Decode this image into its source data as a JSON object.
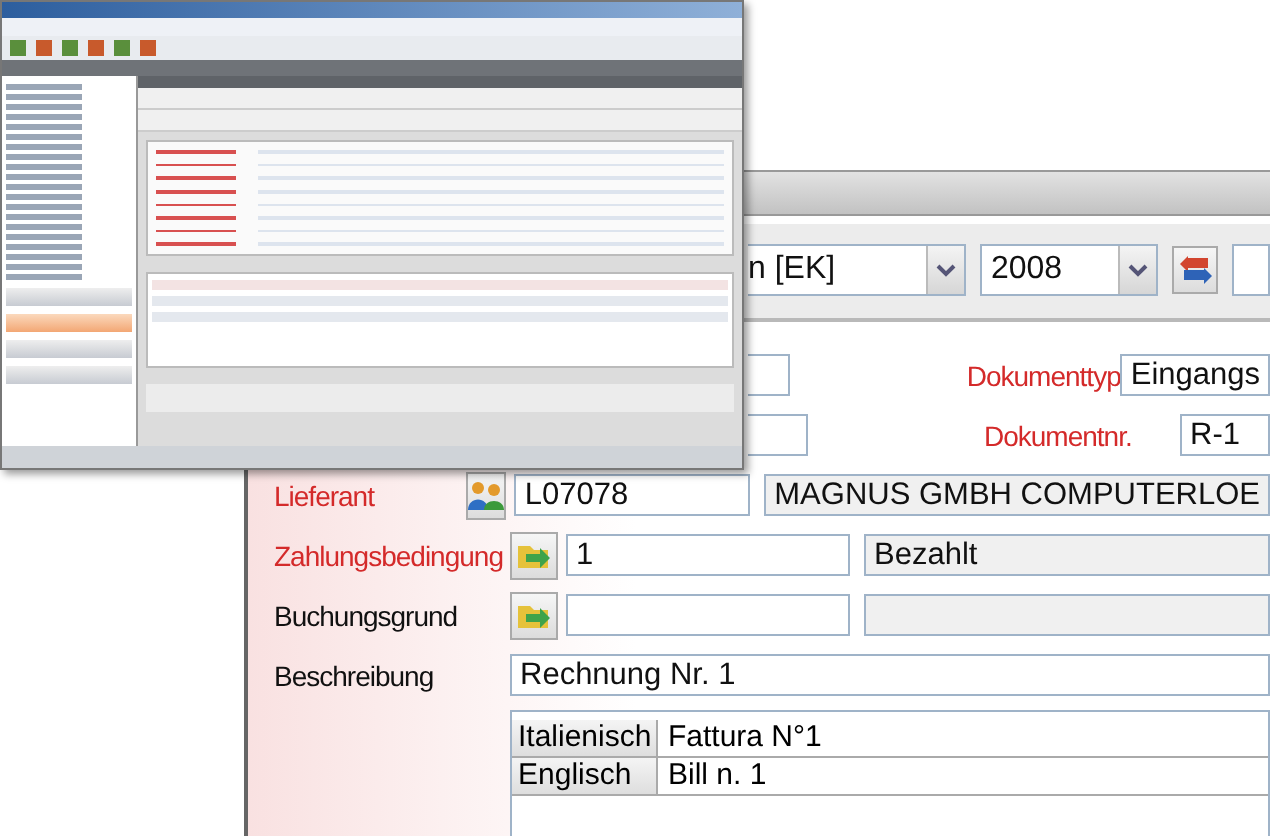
{
  "toolbar": {
    "booking_type": {
      "value": "n [EK]"
    },
    "year": {
      "value": "2008"
    }
  },
  "document_fields": [
    {
      "label": "Dokumenttyp",
      "required": true,
      "value": "Eingangs"
    },
    {
      "label": "Dokumentnr.",
      "required": true,
      "value": "R-1"
    }
  ],
  "lookups": [
    {
      "kind": "people",
      "label": "Lieferant",
      "required": true,
      "code": "L07078",
      "name": "MAGNUS GMBH COMPUTERLOE"
    },
    {
      "kind": "terms",
      "label": "Zahlungsbedingung",
      "required": true,
      "code": "1",
      "name": "Bezahlt"
    },
    {
      "kind": "terms",
      "label": "Buchungsgrund",
      "required": false
    }
  ],
  "description": {
    "label": "Beschreibung",
    "value": "Rechnung Nr. 1"
  },
  "translations": [
    {
      "language": "Italienisch",
      "text": "Fattura N°1"
    },
    {
      "language": "Englisch",
      "text": "Bill n. 1"
    }
  ]
}
